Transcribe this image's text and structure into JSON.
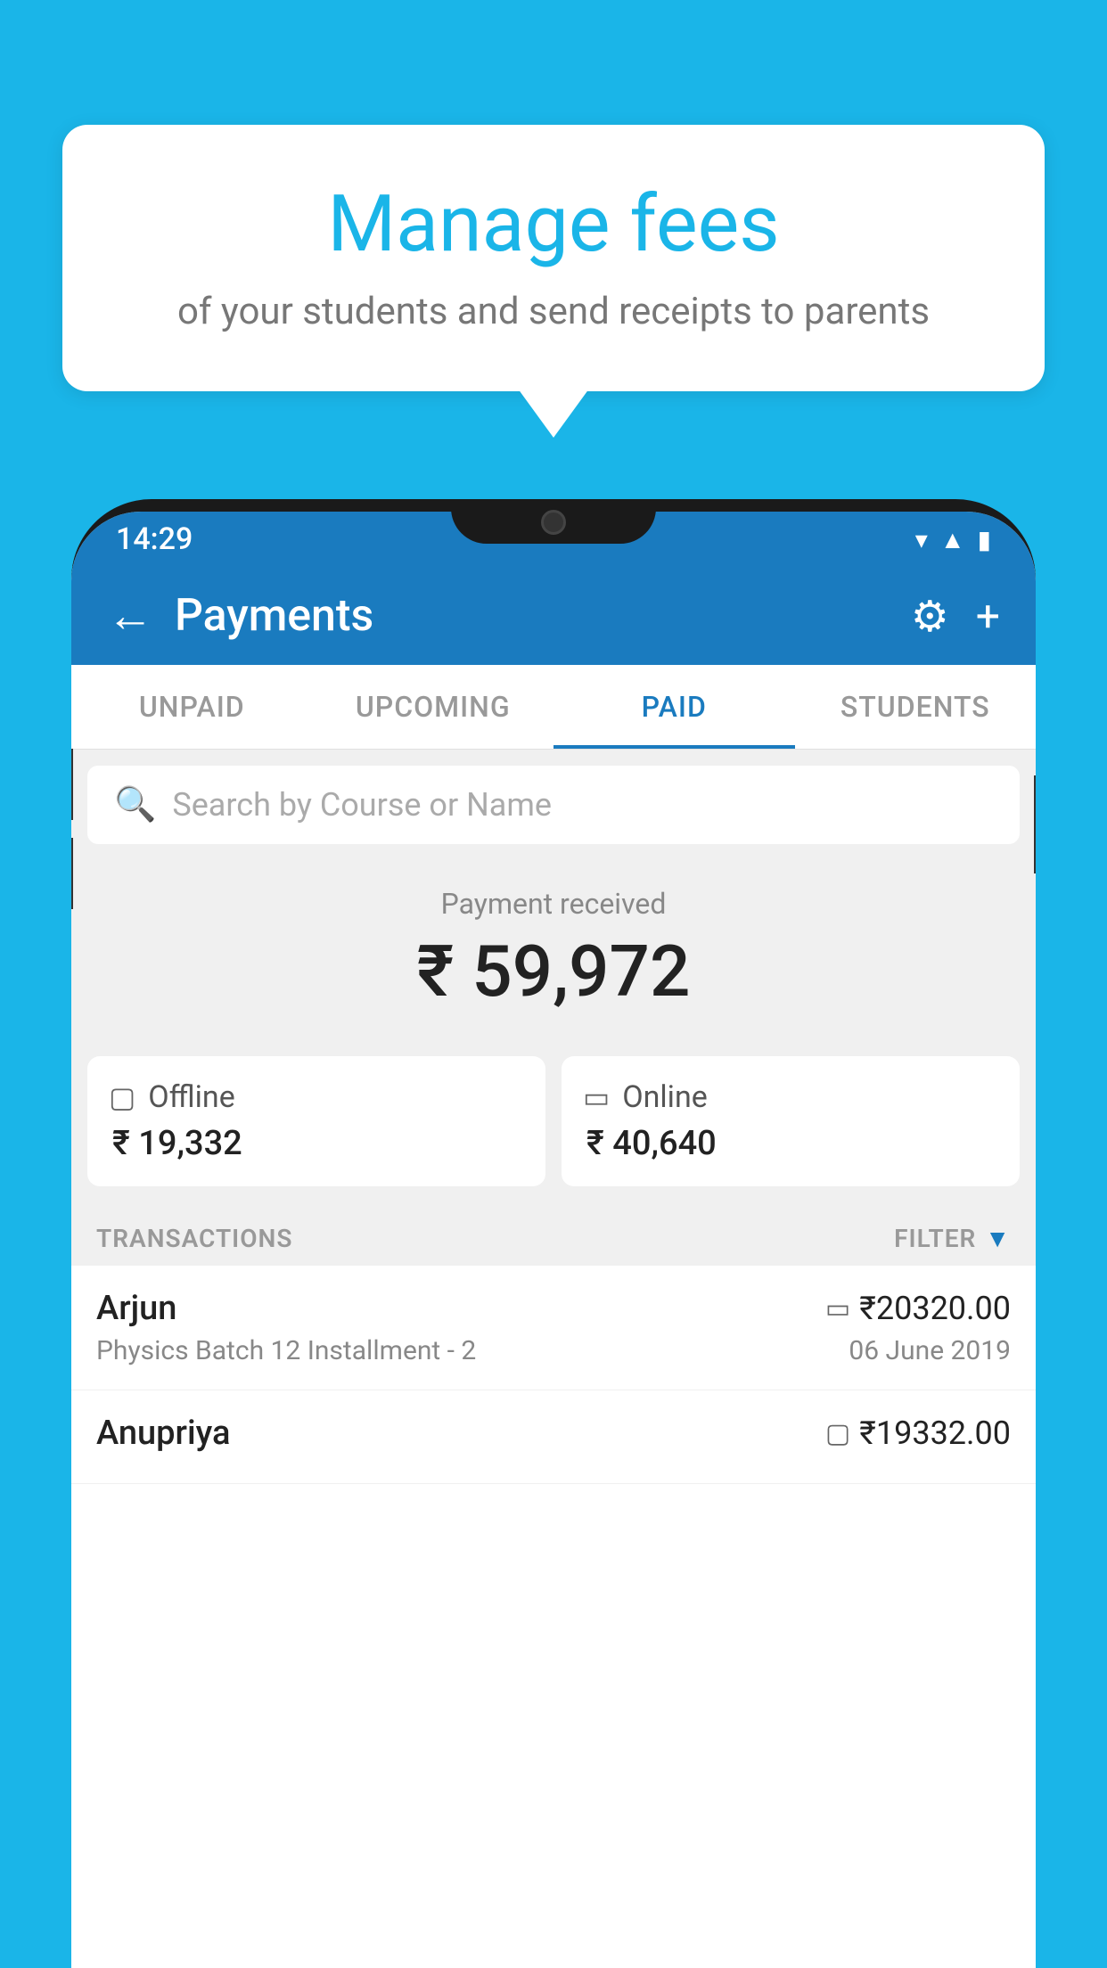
{
  "background": {
    "color": "#1ab5e8"
  },
  "bubble": {
    "title": "Manage fees",
    "subtitle": "of your students and send receipts to parents"
  },
  "status_bar": {
    "time": "14:29",
    "wifi": "▾",
    "signal": "▾",
    "battery": "▮"
  },
  "app_bar": {
    "title": "Payments",
    "back_label": "←",
    "gear_label": "⚙",
    "plus_label": "+"
  },
  "tabs": [
    {
      "id": "unpaid",
      "label": "UNPAID",
      "active": false
    },
    {
      "id": "upcoming",
      "label": "UPCOMING",
      "active": false
    },
    {
      "id": "paid",
      "label": "PAID",
      "active": true
    },
    {
      "id": "students",
      "label": "STUDENTS",
      "active": false
    }
  ],
  "search": {
    "placeholder": "Search by Course or Name"
  },
  "payment_summary": {
    "label": "Payment received",
    "amount": "₹ 59,972"
  },
  "payment_cards": [
    {
      "type": "Offline",
      "amount": "₹ 19,332",
      "icon": "offline"
    },
    {
      "type": "Online",
      "amount": "₹ 40,640",
      "icon": "online"
    }
  ],
  "transactions_section": {
    "label": "TRANSACTIONS",
    "filter_label": "FILTER"
  },
  "transactions": [
    {
      "name": "Arjun",
      "amount": "₹20320.00",
      "course": "Physics Batch 12 Installment - 2",
      "date": "06 June 2019",
      "type": "online"
    },
    {
      "name": "Anupriya",
      "amount": "₹19332.00",
      "course": "",
      "date": "",
      "type": "offline"
    }
  ]
}
